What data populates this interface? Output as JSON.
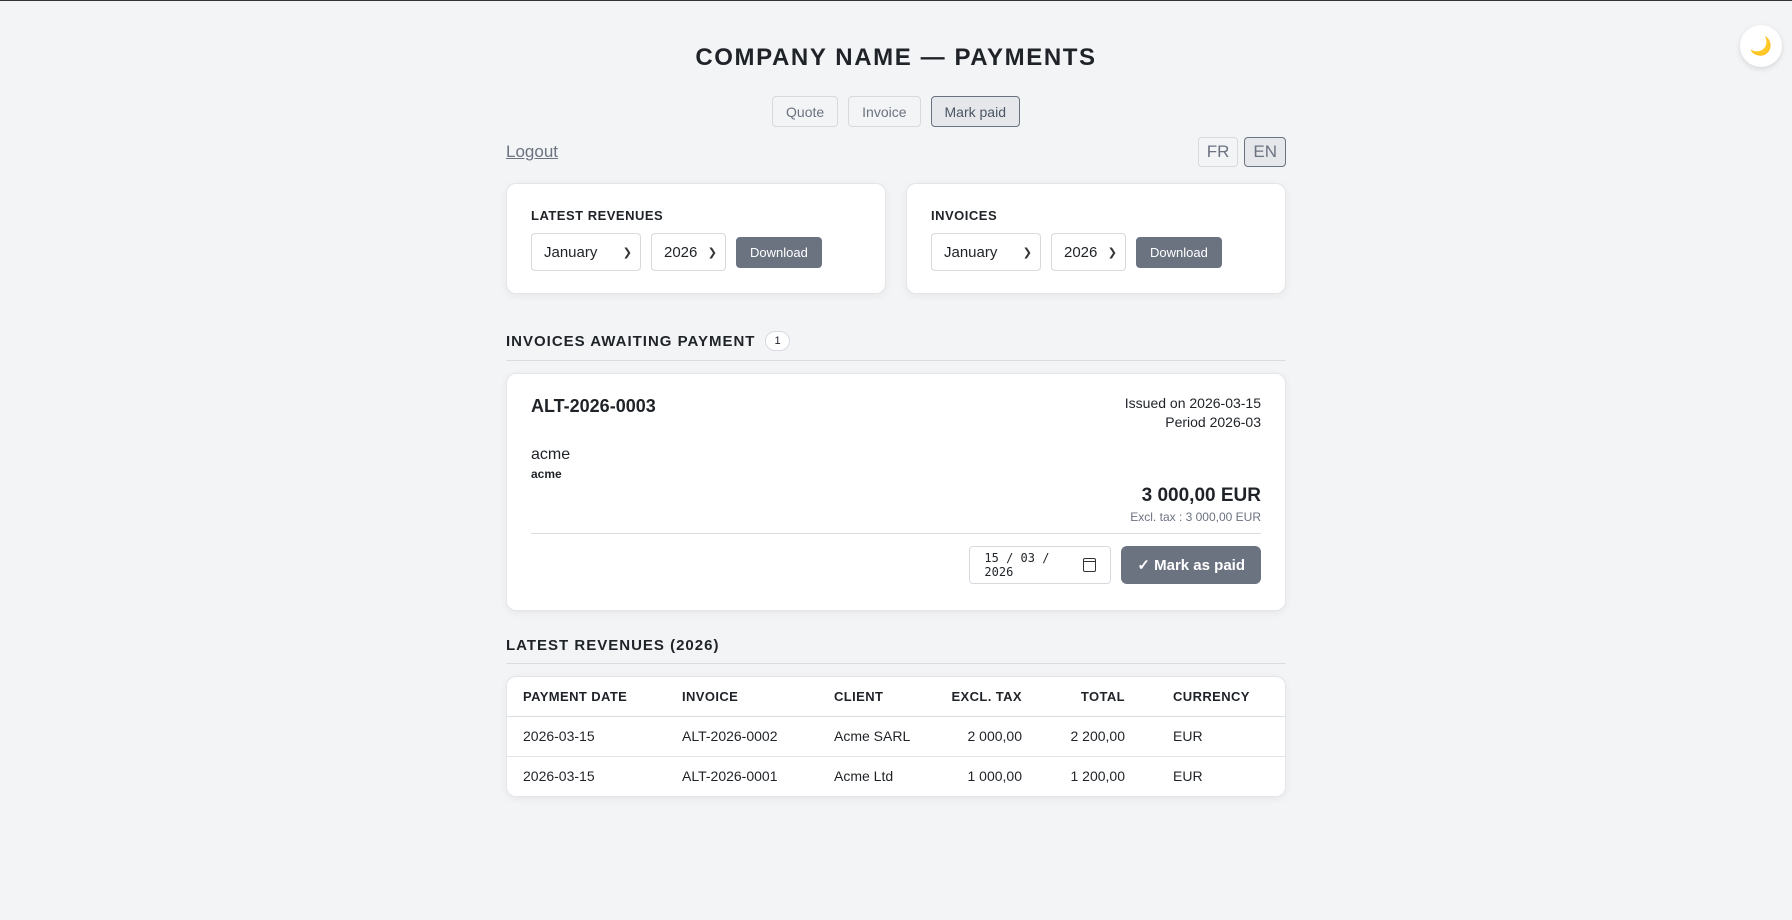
{
  "theme_toggle_icon": "🌙",
  "header": {
    "title": "COMPANY NAME — PAYMENTS"
  },
  "nav": {
    "quote": "Quote",
    "invoice": "Invoice",
    "mark_paid": "Mark paid"
  },
  "logout": "Logout",
  "lang": {
    "fr": "FR",
    "en": "EN"
  },
  "revenues_card": {
    "title": "LATEST REVENUES",
    "month": "January",
    "year": "2026",
    "download": "Download"
  },
  "invoices_card": {
    "title": "INVOICES",
    "month": "January",
    "year": "2026",
    "download": "Download"
  },
  "awaiting": {
    "title": "INVOICES AWAITING PAYMENT",
    "count": "1",
    "invoice": {
      "number": "ALT-2026-0003",
      "issued": "Issued on 2026-03-15",
      "period": "Period 2026-03",
      "client": "acme",
      "client_sub": "acme",
      "amount": "3 000,00 EUR",
      "excl_tax": "Excl. tax : 3 000,00 EUR",
      "date_value": "15 / 03 / 2026",
      "mark_button": "✓ Mark as paid"
    }
  },
  "revenues_table": {
    "title": "LATEST REVENUES (2026)",
    "headers": {
      "date": "PAYMENT DATE",
      "invoice": "INVOICE",
      "client": "CLIENT",
      "excl": "EXCL. TAX",
      "total": "TOTAL",
      "currency": "CURRENCY"
    },
    "rows": [
      {
        "date": "2026-03-15",
        "invoice": "ALT-2026-0002",
        "client": "Acme SARL",
        "excl": "2 000,00",
        "total": "2 200,00",
        "currency": "EUR"
      },
      {
        "date": "2026-03-15",
        "invoice": "ALT-2026-0001",
        "client": "Acme Ltd",
        "excl": "1 000,00",
        "total": "1 200,00",
        "currency": "EUR"
      }
    ]
  }
}
